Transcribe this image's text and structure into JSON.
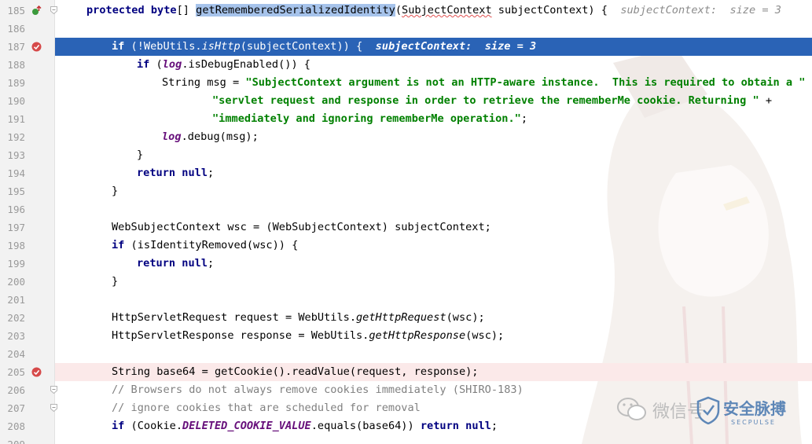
{
  "lines": [
    {
      "num": "185",
      "parts": [
        [
          "kw",
          "protected byte"
        ],
        [
          "plain",
          "[] "
        ],
        [
          "sel",
          "getRememberedSerializedIdentity"
        ],
        [
          "plain",
          "("
        ],
        [
          "squig",
          "SubjectContext"
        ],
        [
          "plain",
          " subjectContext) {  "
        ],
        [
          "hint",
          "subjectContext:  size = 3"
        ]
      ]
    },
    {
      "num": "186",
      "parts": []
    },
    {
      "num": "187",
      "parts": [
        [
          "kw",
          "if"
        ],
        [
          "plain",
          " (!WebUtils."
        ],
        [
          "plain",
          "isHttp"
        ],
        [
          "plain",
          "(subjectContext)) {  "
        ],
        [
          "hintinline",
          "subjectContext:  size = 3"
        ]
      ]
    },
    {
      "num": "188",
      "parts": [
        [
          "kw",
          "if"
        ],
        [
          "plain",
          " ("
        ],
        [
          "fld",
          "log"
        ],
        [
          "plain",
          ".isDebugEnabled()) {"
        ]
      ]
    },
    {
      "num": "189",
      "parts": [
        [
          "plain",
          "String msg = "
        ],
        [
          "str",
          "\"SubjectContext argument is not an HTTP-aware instance.  This is required to obtain a \""
        ],
        [
          "plain",
          " +"
        ]
      ]
    },
    {
      "num": "190",
      "parts": [
        [
          "str",
          "\"servlet request and response in order to retrieve the rememberMe cookie. Returning \""
        ],
        [
          "plain",
          " +"
        ]
      ]
    },
    {
      "num": "191",
      "parts": [
        [
          "str",
          "\"immediately and ignoring rememberMe operation.\""
        ],
        [
          "plain",
          ";"
        ]
      ]
    },
    {
      "num": "192",
      "parts": [
        [
          "fld",
          "log"
        ],
        [
          "plain",
          ".debug(msg);"
        ]
      ]
    },
    {
      "num": "193",
      "parts": [
        [
          "plain",
          "}"
        ]
      ]
    },
    {
      "num": "194",
      "parts": [
        [
          "kw",
          "return null"
        ],
        [
          "plain",
          ";"
        ]
      ]
    },
    {
      "num": "195",
      "parts": [
        [
          "plain",
          "}"
        ]
      ]
    },
    {
      "num": "196",
      "parts": []
    },
    {
      "num": "197",
      "parts": [
        [
          "plain",
          "WebSubjectContext wsc = (WebSubjectContext) subjectContext;"
        ]
      ]
    },
    {
      "num": "198",
      "parts": [
        [
          "kw",
          "if"
        ],
        [
          "plain",
          " (isIdentityRemoved(wsc)) {"
        ]
      ]
    },
    {
      "num": "199",
      "parts": [
        [
          "kw",
          "return null"
        ],
        [
          "plain",
          ";"
        ]
      ]
    },
    {
      "num": "200",
      "parts": [
        [
          "plain",
          "}"
        ]
      ]
    },
    {
      "num": "201",
      "parts": []
    },
    {
      "num": "202",
      "parts": [
        [
          "plain",
          "HttpServletRequest request = WebUtils."
        ],
        [
          "plain",
          "getHttpRequest"
        ],
        [
          "plain",
          "(wsc);"
        ]
      ]
    },
    {
      "num": "203",
      "parts": [
        [
          "plain",
          "HttpServletResponse response = WebUtils."
        ],
        [
          "plain",
          "getHttpResponse"
        ],
        [
          "plain",
          "(wsc);"
        ]
      ]
    },
    {
      "num": "204",
      "parts": []
    },
    {
      "num": "205",
      "parts": [
        [
          "plain",
          "String base64 = getCookie().readValue(request, response);"
        ]
      ]
    },
    {
      "num": "206",
      "parts": [
        [
          "cmt",
          "// Browsers do not always remove cookies immediately (SHIRO-183)"
        ]
      ]
    },
    {
      "num": "207",
      "parts": [
        [
          "cmt",
          "// ignore cookies that are scheduled for removal"
        ]
      ]
    },
    {
      "num": "208",
      "parts": [
        [
          "kw",
          "if"
        ],
        [
          "plain",
          " (Cookie."
        ],
        [
          "fld",
          "DELETED_COOKIE_VALUE"
        ],
        [
          "plain",
          ".equals(base64)) "
        ],
        [
          "kw",
          "return null"
        ],
        [
          "plain",
          ";"
        ]
      ]
    },
    {
      "num": "209",
      "parts": []
    }
  ],
  "watermark": {
    "text": "微信号",
    "brand": "安全脉搏",
    "sub": "SECPULSE"
  },
  "icons": {
    "breakpoint": "breakpoint-icon",
    "override": "override-icon",
    "fold": "fold-icon"
  },
  "colors": {
    "blue_highlight": "#2a63b6",
    "red_highlight": "#fbe9e9",
    "keyword": "#000080",
    "string": "#008000",
    "static_field": "#660e7a",
    "comment": "#808080",
    "breakpoint": "#d64a4a"
  }
}
